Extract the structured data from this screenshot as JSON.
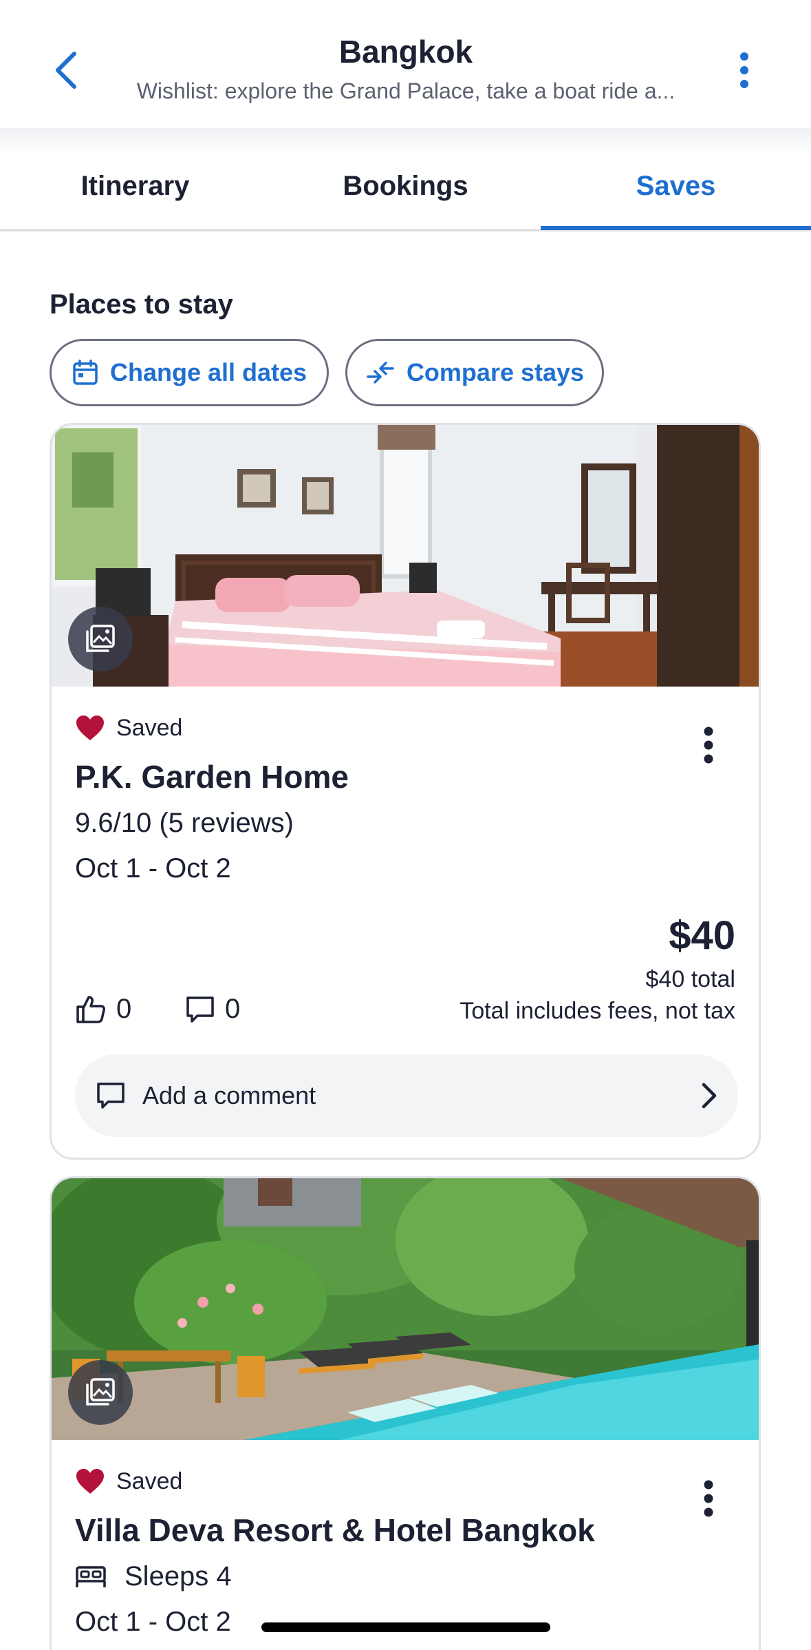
{
  "header": {
    "title": "Bangkok",
    "subtitle": "Wishlist: explore the Grand Palace, take a boat ride a..."
  },
  "tabs": [
    {
      "label": "Itinerary",
      "active": false
    },
    {
      "label": "Bookings",
      "active": false
    },
    {
      "label": "Saves",
      "active": true
    }
  ],
  "section": {
    "title": "Places to stay",
    "change_dates_label": "Change all dates",
    "compare_label": "Compare stays"
  },
  "colors": {
    "accent": "#1f6fd1",
    "heart": "#b3123b",
    "text": "#1c2133"
  },
  "cards": [
    {
      "saved_label": "Saved",
      "name": "P.K. Garden Home",
      "rating": "9.6/10 (5 reviews)",
      "dates": "Oct 1 - Oct 2",
      "price": "$40",
      "price_total": "$40 total",
      "price_note": "Total includes fees, not tax",
      "likes": "0",
      "comments": "0",
      "comment_placeholder": "Add a comment"
    },
    {
      "saved_label": "Saved",
      "name": "Villa Deva Resort & Hotel Bangkok",
      "sleeps": "Sleeps 4",
      "dates": "Oct 1 - Oct 2"
    }
  ]
}
